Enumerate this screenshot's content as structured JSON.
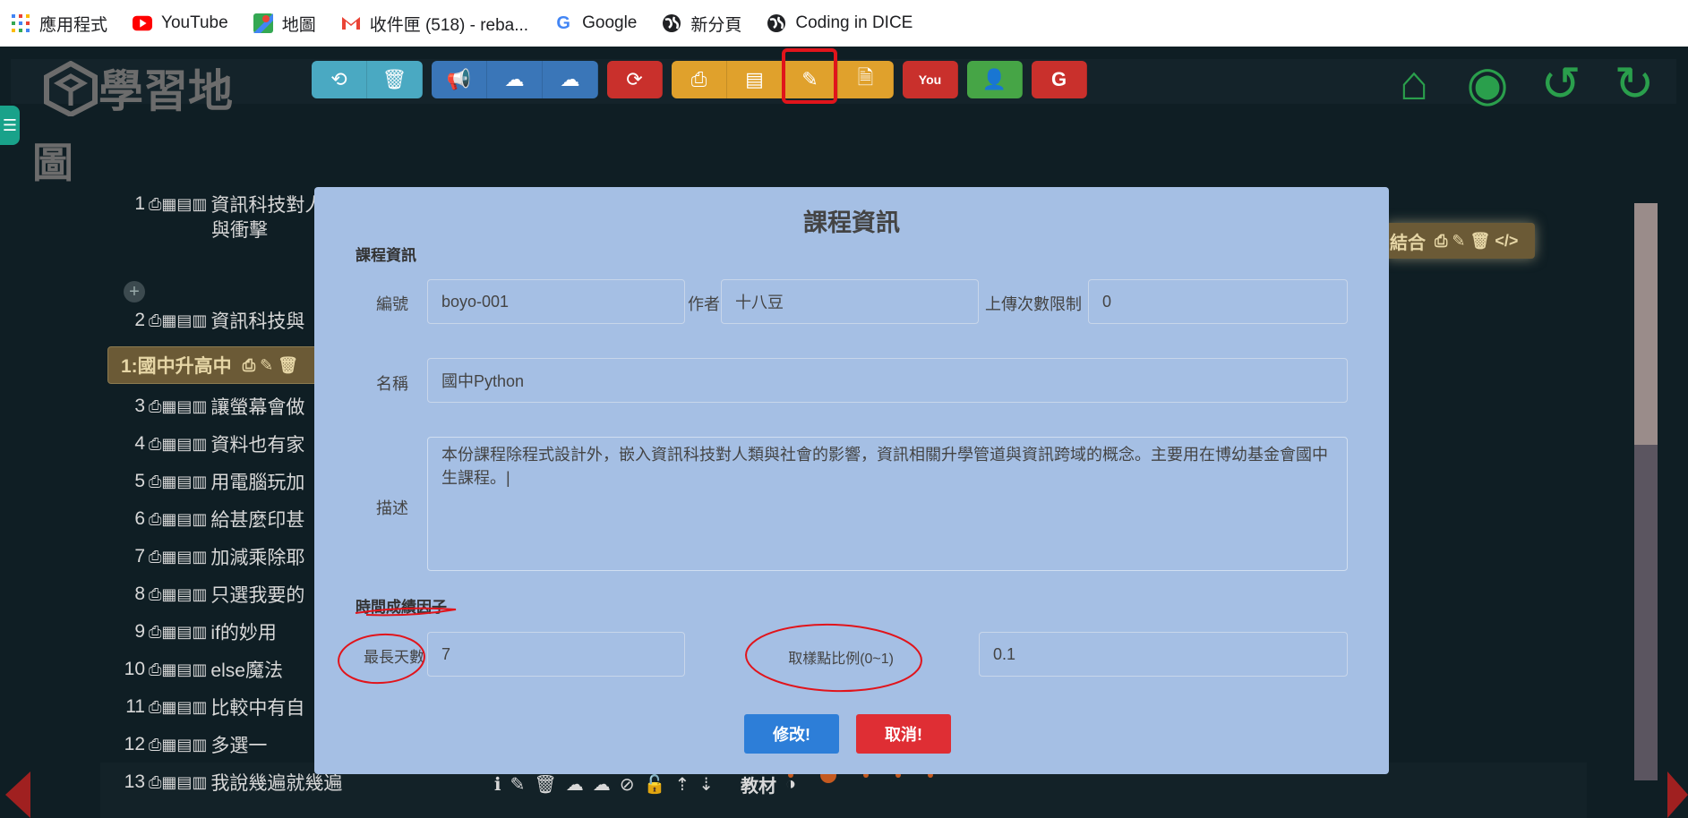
{
  "bookmarks": [
    {
      "icon": "apps-grid-icon",
      "label": "應用程式"
    },
    {
      "icon": "youtube-icon",
      "label": "YouTube"
    },
    {
      "icon": "maps-icon",
      "label": "地圖"
    },
    {
      "icon": "gmail-icon",
      "label": "收件匣 (518) - reba..."
    },
    {
      "icon": "google-icon",
      "label": "Google"
    },
    {
      "icon": "globe-icon",
      "label": "新分頁"
    },
    {
      "icon": "globe-icon",
      "label": "Coding in DICE"
    }
  ],
  "app": {
    "logo_line1": "學習地",
    "logo_line2": "圖"
  },
  "list": {
    "rows": [
      {
        "num": "1",
        "title": "資訊科技對人",
        "title2": "與衝擊"
      },
      {
        "num": "2",
        "title": "資訊科技與"
      },
      {
        "num": "3",
        "title": "讓螢幕會做"
      },
      {
        "num": "4",
        "title": "資料也有家"
      },
      {
        "num": "5",
        "title": "用電腦玩加"
      },
      {
        "num": "6",
        "title": "給甚麼印甚"
      },
      {
        "num": "7",
        "title": "加減乘除耶"
      },
      {
        "num": "8",
        "title": "只選我要的"
      },
      {
        "num": "9",
        "title": "if的妙用"
      },
      {
        "num": "10",
        "title": "else魔法"
      },
      {
        "num": "11",
        "title": "比較中有自"
      },
      {
        "num": "12",
        "title": "多選一"
      },
      {
        "num": "13",
        "title": "我說幾遍就幾遍"
      }
    ],
    "chapter_label": "1:國中升高中",
    "material_label": "教材",
    "combine_label": "結合"
  },
  "modal": {
    "title": "課程資訊",
    "section_info": "課程資訊",
    "id_label": "編號",
    "id_value": "boyo-001",
    "author_label": "作者",
    "author_value": "十八豆",
    "upload_limit_label": "上傳次數限制",
    "upload_limit_value": "0",
    "name_label": "名稱",
    "name_value": "國中Python",
    "desc_label": "描述",
    "desc_value": "本份課程除程式設計外，嵌入資訊科技對人類與社會的影響，資訊相關升學管道與資訊跨域的概念。主要用在博幼基金會國中生課程。|",
    "section_time": "時間成績因子",
    "max_days_label": "最長天數",
    "max_days_value": "7",
    "sample_ratio_label": "取樣點比例(0~1)",
    "sample_ratio_value": "0.1",
    "modify_button": "修改!",
    "cancel_button": "取消!"
  },
  "colors": {
    "modal_bg": "#a5bfe4",
    "modify_btn": "#2d7ed8",
    "cancel_btn": "#df2e34",
    "annotation": "#e1141b"
  }
}
